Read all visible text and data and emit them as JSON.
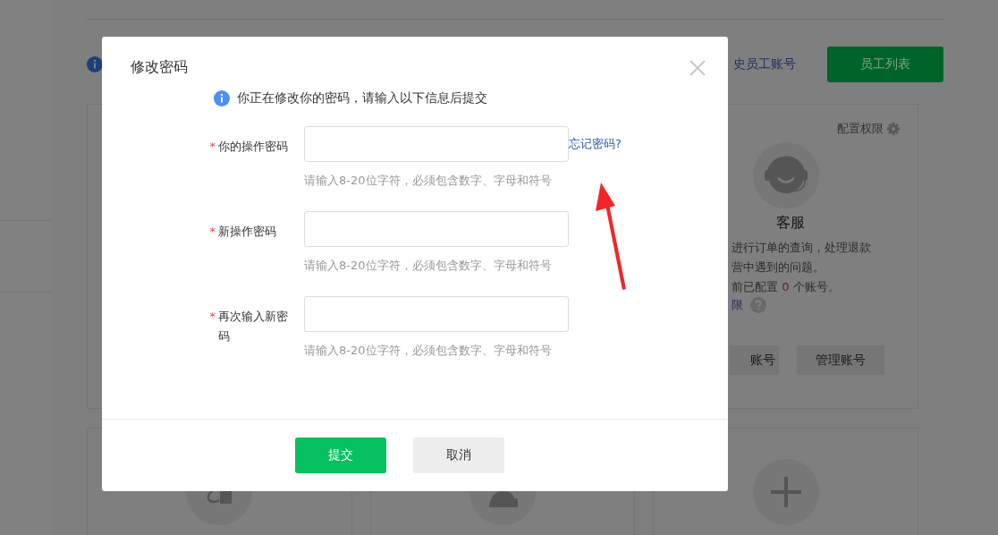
{
  "page": {
    "history_link": "史员工账号",
    "staff_list_button": "员工列表",
    "role_card": {
      "permission_link": "配置权限",
      "title": "客服",
      "description_lines": [
        "进行订单的查询，处理退款",
        "营中遇到的问题。"
      ],
      "count_prefix": "前已配置 ",
      "count": "0",
      "count_suffix": " 个账号。",
      "help_link": "限",
      "buttons": [
        "账号",
        "管理账号"
      ]
    }
  },
  "dialog": {
    "title": "修改密码",
    "notice": "你正在修改你的密码，请输入以下信息后提交",
    "fields": [
      {
        "label": "你的操作密码",
        "required_mark": "*",
        "hint": "请输入8-20位字符，必须包含数字、字母和符号",
        "link": "忘记密码?"
      },
      {
        "label": "新操作密码",
        "required_mark": "*",
        "hint": "请输入8-20位字符，必须包含数字、字母和符号"
      },
      {
        "label": "再次输入新密码",
        "required_mark": "*",
        "hint": "请输入8-20位字符，必须包含数字、字母和符号"
      }
    ],
    "buttons": [
      {
        "label": "提交",
        "kind": "primary"
      },
      {
        "label": "取消",
        "kind": "secondary"
      }
    ]
  }
}
